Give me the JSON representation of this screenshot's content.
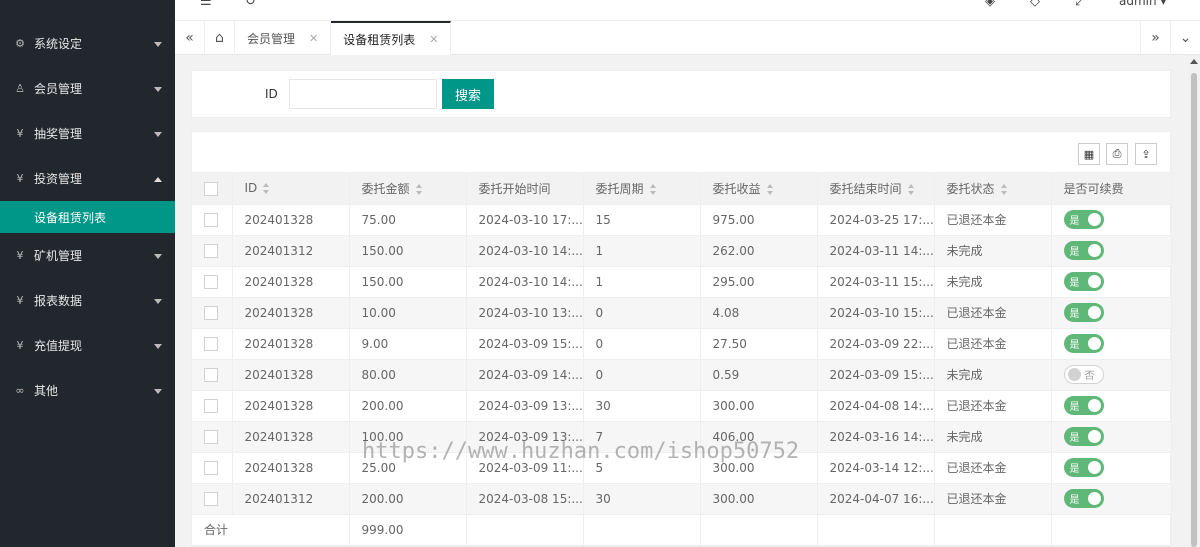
{
  "sidebar": {
    "items": [
      {
        "label": "系统设定",
        "icon": "gear-icon",
        "glyph": "⚙"
      },
      {
        "label": "会员管理",
        "icon": "user-icon",
        "glyph": "♙"
      },
      {
        "label": "抽奖管理",
        "icon": "yen-icon",
        "glyph": "¥"
      },
      {
        "label": "投资管理",
        "icon": "yen-icon",
        "glyph": "¥"
      },
      {
        "label": "矿机管理",
        "icon": "yen-icon",
        "glyph": "¥"
      },
      {
        "label": "报表数据",
        "icon": "yen-icon",
        "glyph": "¥"
      },
      {
        "label": "充值提现",
        "icon": "yen-icon",
        "glyph": "¥"
      },
      {
        "label": "其他",
        "icon": "link-icon",
        "glyph": "∞"
      }
    ],
    "active_sub": "设备租赁列表"
  },
  "topbar": {
    "user": "admin"
  },
  "tabs": [
    {
      "label": "会员管理"
    },
    {
      "label": "设备租赁列表"
    }
  ],
  "search": {
    "id_label": "ID",
    "button": "搜索"
  },
  "table": {
    "headers": [
      "ID",
      "委托金额",
      "委托开始时间",
      "委托周期",
      "委托收益",
      "委托结束时间",
      "委托状态",
      "是否可续费"
    ],
    "rows": [
      {
        "id": "202401328",
        "amount": "75.00",
        "start": "2024-03-10 17:...",
        "period": "15",
        "profit": "975.00",
        "end": "2024-03-25 17:...",
        "status": "已退还本金",
        "renew": "是"
      },
      {
        "id": "202401312",
        "amount": "150.00",
        "start": "2024-03-10 14:...",
        "period": "1",
        "profit": "262.00",
        "end": "2024-03-11 14:...",
        "status": "未完成",
        "renew": "是"
      },
      {
        "id": "202401328",
        "amount": "150.00",
        "start": "2024-03-10 14:...",
        "period": "1",
        "profit": "295.00",
        "end": "2024-03-11 15:...",
        "status": "未完成",
        "renew": "是"
      },
      {
        "id": "202401328",
        "amount": "10.00",
        "start": "2024-03-10 13:...",
        "period": "0",
        "profit": "4.08",
        "end": "2024-03-10 15:...",
        "status": "已退还本金",
        "renew": "是"
      },
      {
        "id": "202401328",
        "amount": "9.00",
        "start": "2024-03-09 15:...",
        "period": "0",
        "profit": "27.50",
        "end": "2024-03-09 22:...",
        "status": "已退还本金",
        "renew": "是"
      },
      {
        "id": "202401328",
        "amount": "80.00",
        "start": "2024-03-09 14:...",
        "period": "0",
        "profit": "0.59",
        "end": "2024-03-09 15:...",
        "status": "未完成",
        "renew": "否"
      },
      {
        "id": "202401328",
        "amount": "200.00",
        "start": "2024-03-09 13:...",
        "period": "30",
        "profit": "300.00",
        "end": "2024-04-08 14:...",
        "status": "已退还本金",
        "renew": "是"
      },
      {
        "id": "202401328",
        "amount": "100.00",
        "start": "2024-03-09 13:...",
        "period": "7",
        "profit": "406.00",
        "end": "2024-03-16 14:...",
        "status": "未完成",
        "renew": "是"
      },
      {
        "id": "202401328",
        "amount": "25.00",
        "start": "2024-03-09 11:...",
        "period": "5",
        "profit": "300.00",
        "end": "2024-03-14 12:...",
        "status": "已退还本金",
        "renew": "是"
      },
      {
        "id": "202401312",
        "amount": "200.00",
        "start": "2024-03-08 15:...",
        "period": "30",
        "profit": "300.00",
        "end": "2024-04-07 16:...",
        "status": "已退还本金",
        "renew": "是"
      }
    ],
    "total_label": "合计",
    "total_amount": "999.00"
  },
  "watermark": "https://www.huzhan.com/ishop50752",
  "colors": {
    "primary": "#009688",
    "switch_on": "#5FB878",
    "sidebar": "#22272e"
  }
}
